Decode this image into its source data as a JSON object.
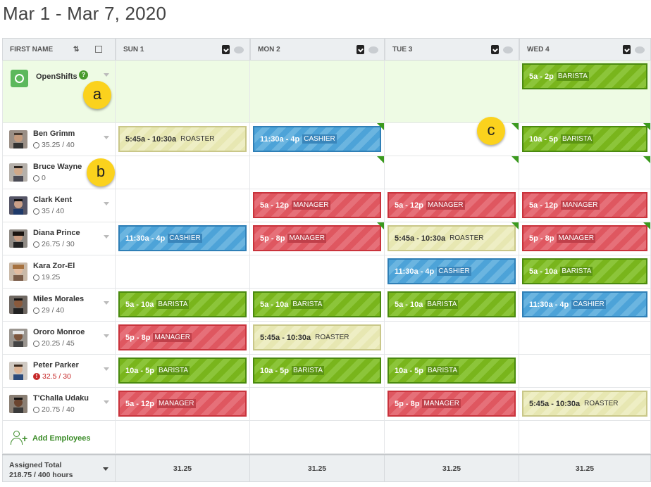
{
  "title": "Mar 1 - Mar 7, 2020",
  "header": {
    "first_name": "FIRST NAME",
    "days": [
      "SUN 1",
      "MON 2",
      "TUE 3",
      "WED 4"
    ]
  },
  "openshifts": {
    "label": "OpenShifts"
  },
  "employees": [
    {
      "name": "Ben Grimm",
      "hours": "35.25 / 40",
      "warn": false
    },
    {
      "name": "Bruce Wayne",
      "hours": "0",
      "warn": false
    },
    {
      "name": "Clark Kent",
      "hours": "35 / 40",
      "warn": false
    },
    {
      "name": "Diana Prince",
      "hours": "26.75 / 30",
      "warn": false
    },
    {
      "name": "Kara Zor-El",
      "hours": "19.25",
      "warn": false
    },
    {
      "name": "Miles Morales",
      "hours": "29 / 40",
      "warn": false
    },
    {
      "name": "Ororo Monroe",
      "hours": "20.25 / 45",
      "warn": false
    },
    {
      "name": "Peter Parker",
      "hours": "32.5 / 30",
      "warn": true
    },
    {
      "name": "T'Challa Udaku",
      "hours": "20.75 / 40",
      "warn": false
    }
  ],
  "shifts": {
    "open_wed": {
      "time": "5a - 2p",
      "role": "BARISTA"
    },
    "ben_sun": {
      "time": "5:45a - 10:30a",
      "role": "ROASTER"
    },
    "ben_mon": {
      "time": "11:30a - 4p",
      "role": "CASHIER"
    },
    "ben_wed": {
      "time": "10a - 5p",
      "role": "BARISTA"
    },
    "clark_mon": {
      "time": "5a - 12p",
      "role": "MANAGER"
    },
    "clark_tue": {
      "time": "5a - 12p",
      "role": "MANAGER"
    },
    "clark_wed": {
      "time": "5a - 12p",
      "role": "MANAGER"
    },
    "diana_sun": {
      "time": "11:30a - 4p",
      "role": "CASHIER"
    },
    "diana_mon": {
      "time": "5p - 8p",
      "role": "MANAGER"
    },
    "diana_tue": {
      "time": "5:45a - 10:30a",
      "role": "ROASTER"
    },
    "diana_wed": {
      "time": "5p - 8p",
      "role": "MANAGER"
    },
    "kara_tue": {
      "time": "11:30a - 4p",
      "role": "CASHIER"
    },
    "kara_wed": {
      "time": "5a - 10a",
      "role": "BARISTA"
    },
    "miles_sun": {
      "time": "5a - 10a",
      "role": "BARISTA"
    },
    "miles_mon": {
      "time": "5a - 10a",
      "role": "BARISTA"
    },
    "miles_tue": {
      "time": "5a - 10a",
      "role": "BARISTA"
    },
    "miles_wed": {
      "time": "11:30a - 4p",
      "role": "CASHIER"
    },
    "ororo_sun": {
      "time": "5p - 8p",
      "role": "MANAGER"
    },
    "ororo_mon": {
      "time": "5:45a - 10:30a",
      "role": "ROASTER"
    },
    "peter_sun": {
      "time": "10a - 5p",
      "role": "BARISTA"
    },
    "peter_mon": {
      "time": "10a - 5p",
      "role": "BARISTA"
    },
    "peter_tue": {
      "time": "10a - 5p",
      "role": "BARISTA"
    },
    "tchalla_sun": {
      "time": "5a - 12p",
      "role": "MANAGER"
    },
    "tchalla_tue": {
      "time": "5p - 8p",
      "role": "MANAGER"
    },
    "tchalla_wed": {
      "time": "5:45a - 10:30a",
      "role": "ROASTER"
    }
  },
  "add_employees": "Add Employees",
  "footer": {
    "label_line1": "Assigned Total",
    "label_line2": "218.75 / 400 hours",
    "totals": [
      "31.25",
      "31.25",
      "31.25",
      "31.25"
    ]
  },
  "callouts": [
    "a",
    "b",
    "c"
  ],
  "colors": {
    "barista": "#79b51c",
    "manager": "#df5760",
    "cashier": "#4da3d8",
    "roaster": "#e7e7b2",
    "open_row_bg": "#eefbe4",
    "callout": "#fbd21d"
  }
}
